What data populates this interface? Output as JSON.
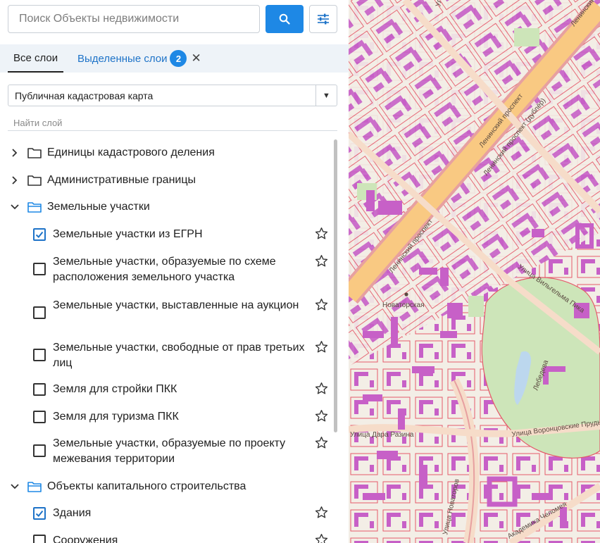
{
  "search": {
    "placeholder": "Поиск Объекты недвижимости",
    "button_icon": "search-icon",
    "filter_icon": "sliders-icon"
  },
  "tabs": {
    "all_label": "Все слои",
    "selected_label": "Выделенные слои",
    "selected_count": "2",
    "close_icon": "close-icon"
  },
  "basemap_select": {
    "value": "Публичная кадастровая карта"
  },
  "layer_search": {
    "placeholder": "Найти слой"
  },
  "tree": {
    "groups": [
      {
        "label": "Единицы кадастрового деления",
        "expanded": false
      },
      {
        "label": "Административные границы",
        "expanded": false
      },
      {
        "label": "Земельные участки",
        "expanded": true
      },
      {
        "label": "Объекты капитального строительства",
        "expanded": true
      }
    ],
    "land_items": [
      {
        "label": "Земельные участки из ЕГРН",
        "checked": true
      },
      {
        "label": "Земельные участки, образуемые по схеме расположения земельного участка",
        "checked": false
      },
      {
        "label": "Земельные участки, выставленные на аукцион",
        "checked": false
      },
      {
        "label": "Земельные участки, свободные от прав третьих лиц",
        "checked": false
      },
      {
        "label": "Земля для стройки ПКК",
        "checked": false
      },
      {
        "label": "Земля для туризма ПКК",
        "checked": false
      },
      {
        "label": "Земельные участки, образуемые по проекту межевания территории",
        "checked": false
      }
    ],
    "building_items": [
      {
        "label": "Здания",
        "checked": true
      },
      {
        "label": "Сооружения",
        "checked": false
      }
    ]
  },
  "map": {
    "street_labels": {
      "leninsky_1": "Ленинский проспект",
      "leninsky_2": "Ленинский проспект (дублёр)",
      "leninsky_3": "Ленинский проспект",
      "novatorskaya": "Новаторская",
      "vilisa": "Улица Вильгельма Пика",
      "vorontsovskie": "Улица Воронцовские Пруды",
      "novatorov": "Улица Новаторов",
      "academika": "Академика Челомея",
      "ulyanova": "Улица Ульяновой",
      "razina": "Улица Дара Разина",
      "leninskiy_top": "Ленинский проспект",
      "lebedeva": "Лебедева"
    },
    "colors": {
      "background": "#f3eee6",
      "road_major": "#f9c982",
      "road_outline": "#e7a0a0",
      "parcel_line": "#e55a6b",
      "building": "#c760c7",
      "park": "#cde5b9",
      "water": "#bcd7ee"
    }
  },
  "accent_color": "#1e88e5"
}
